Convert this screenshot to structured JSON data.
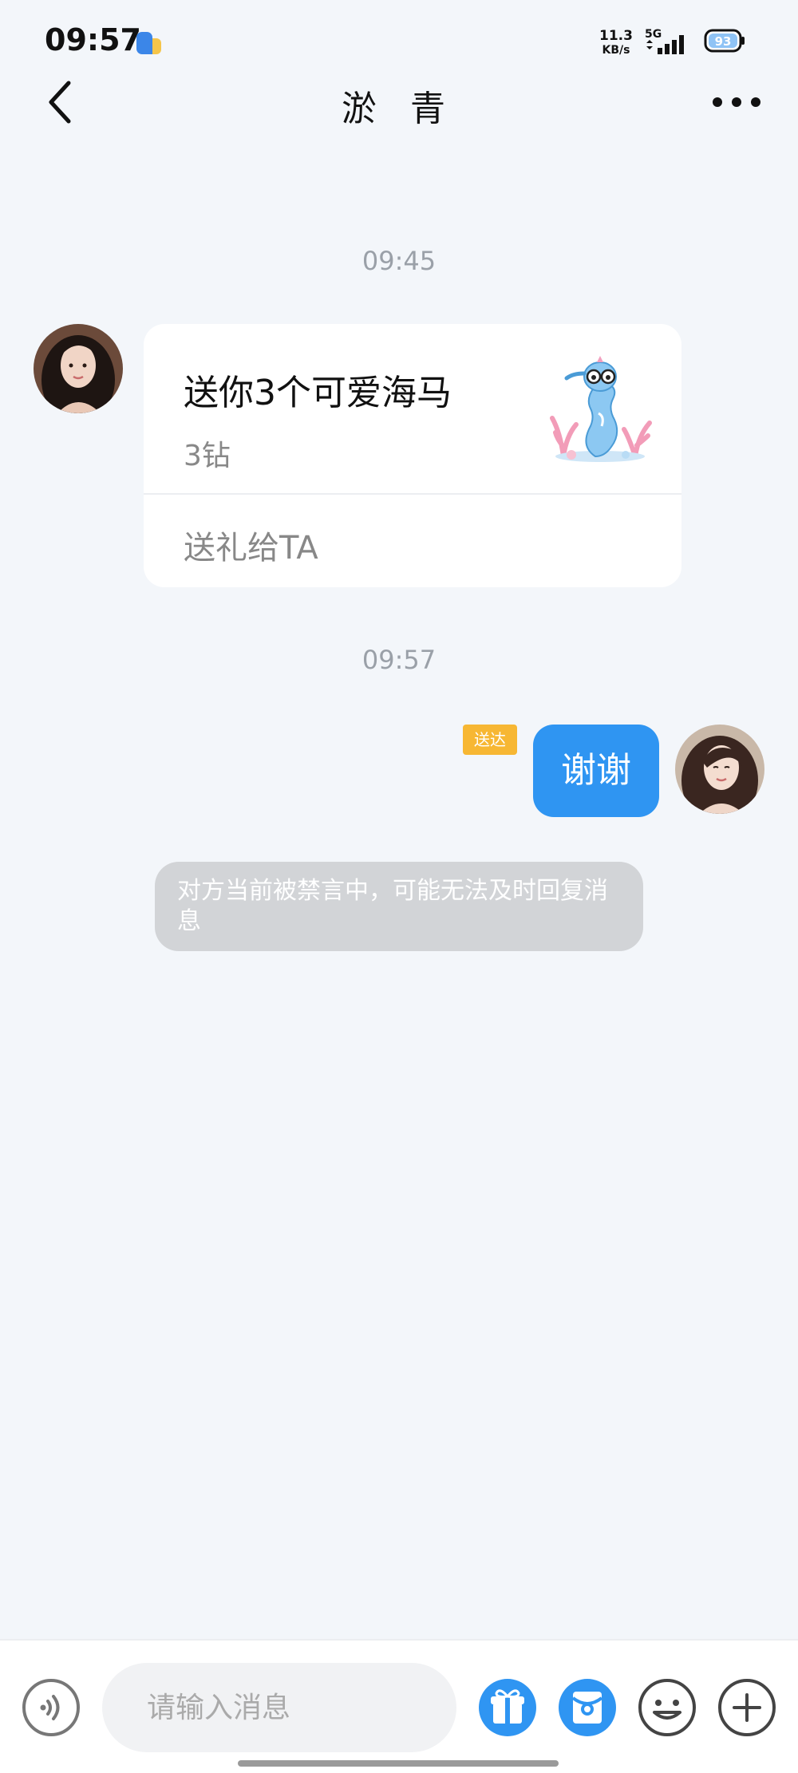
{
  "status_bar": {
    "time": "09:57",
    "net_speed_value": "11.3",
    "net_speed_unit": "KB/s",
    "network_type": "5G",
    "battery_level": "93"
  },
  "header": {
    "title": "淤 青"
  },
  "messages": {
    "timestamp_1": "09:45",
    "gift_card": {
      "title": "送你3个可爱海马",
      "price": "3钻",
      "action": "送礼给TA"
    },
    "timestamp_2": "09:57",
    "delivered_badge": "送达",
    "my_message": "谢谢",
    "system_notice": "对方当前被禁言中，可能无法及时回复消息"
  },
  "input_bar": {
    "placeholder": "请输入消息"
  },
  "colors": {
    "accent": "#2f95f2",
    "background": "#f3f6fa",
    "badge": "#f7b733",
    "notice_bg": "#d2d4d7"
  }
}
